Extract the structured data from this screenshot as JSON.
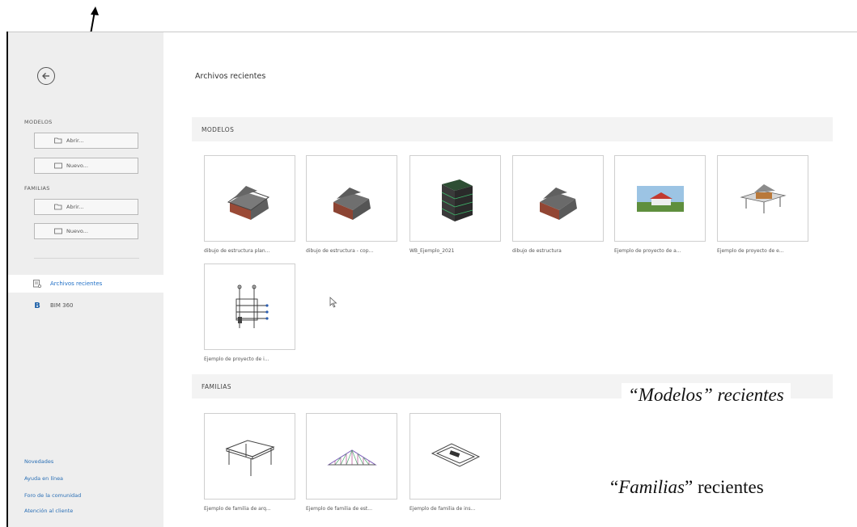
{
  "sidebar": {
    "modelos_label": "MODELOS",
    "modelos_open": "Abrir...",
    "modelos_new": "Nuevo...",
    "familias_label": "FAMILIAS",
    "familias_open": "Abrir...",
    "familias_new": "Nuevo...",
    "nav": [
      {
        "label": "Archivos recientes",
        "icon": "recent-files-icon"
      },
      {
        "label": "BIM 360",
        "icon": "bim360-icon",
        "glyph": "B"
      }
    ],
    "footer": [
      "Novedades",
      "Ayuda en línea",
      "Foro de la comunidad",
      "Atención al cliente"
    ]
  },
  "main": {
    "title": "Archivos recientes",
    "groups": {
      "models": {
        "label": "MODELOS",
        "items": [
          {
            "label": "dibujo de estructura plan...",
            "thumb": "house-model"
          },
          {
            "label": "dibujo de estructura - cop...",
            "thumb": "house-model"
          },
          {
            "label": "WB_Ejemplo_2021",
            "thumb": "building-frame"
          },
          {
            "label": "dibujo de estructura",
            "thumb": "house-model"
          },
          {
            "label": "Ejemplo de proyecto de a...",
            "thumb": "render-photo"
          },
          {
            "label": "Ejemplo de proyecto de e...",
            "thumb": "deck-structure"
          },
          {
            "label": "Ejemplo de proyecto de i...",
            "thumb": "schematic"
          }
        ]
      },
      "families": {
        "label": "FAMILIAS",
        "items": [
          {
            "label": "Ejemplo de familia de arq...",
            "thumb": "table"
          },
          {
            "label": "Ejemplo de familia de est...",
            "thumb": "truss"
          },
          {
            "label": "Ejemplo de familia de ins...",
            "thumb": "tray"
          }
        ]
      }
    }
  },
  "annotations": {
    "models": "“Modelos” recientes",
    "families_quote_open": "“",
    "families_word": "Familias",
    "families_rest": "” recientes"
  }
}
